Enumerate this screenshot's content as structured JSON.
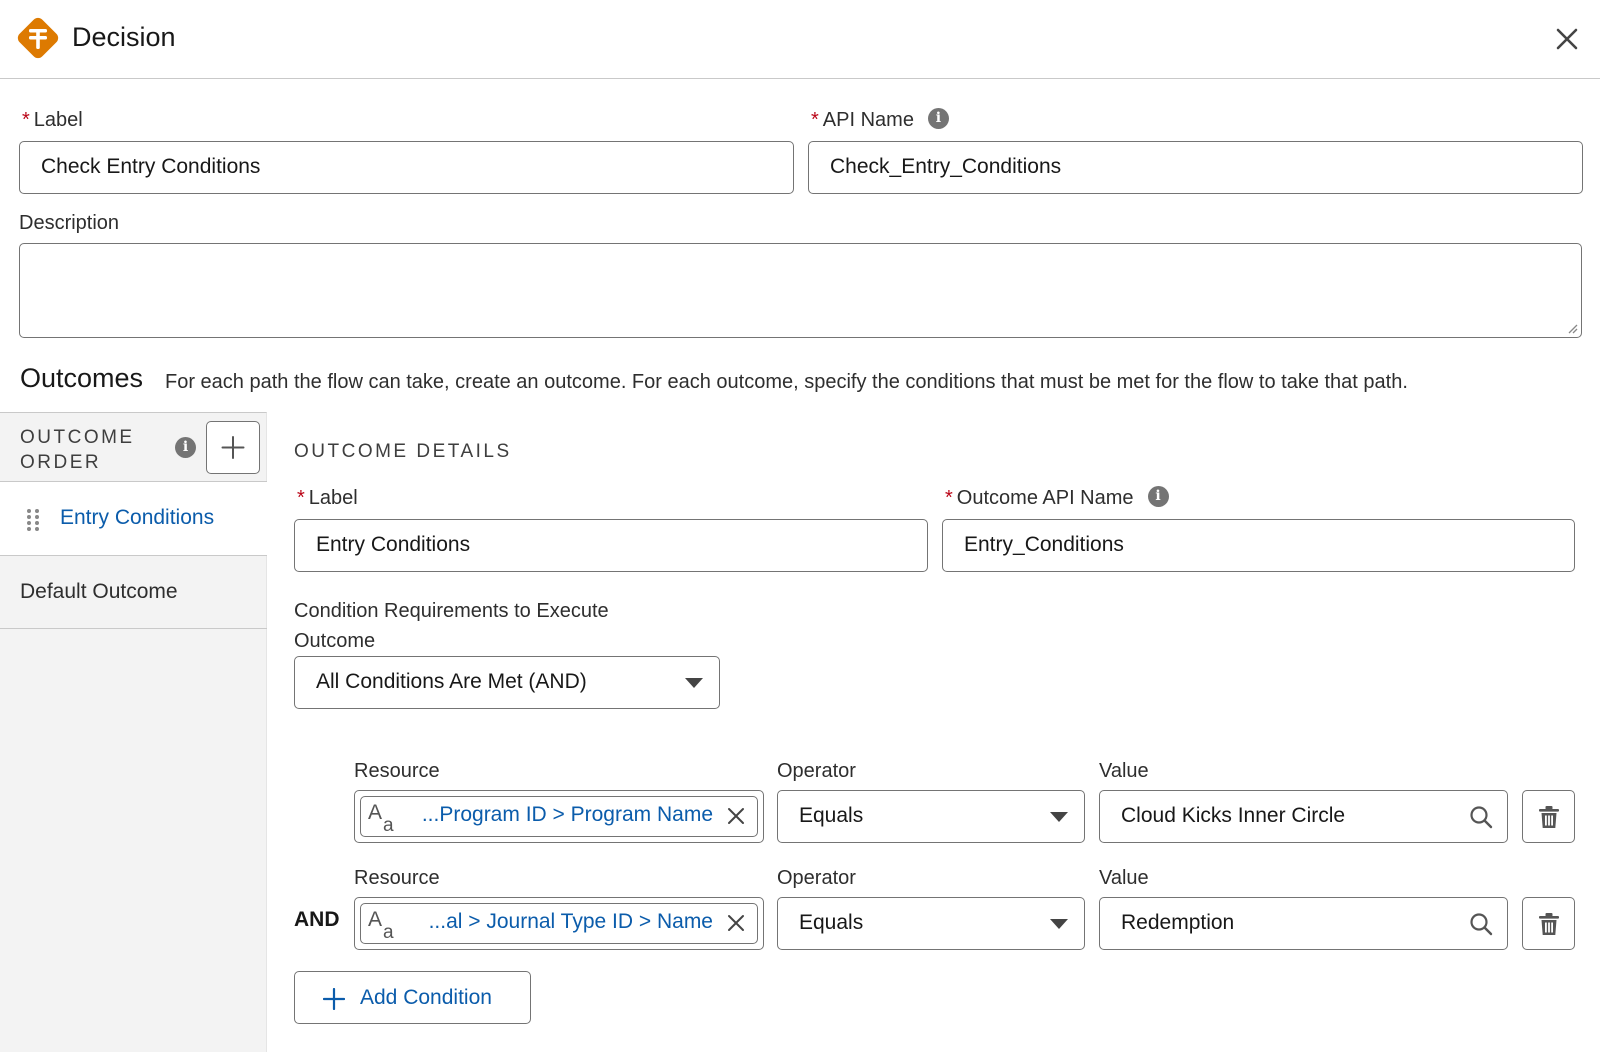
{
  "header": {
    "title": "Decision"
  },
  "form": {
    "label_field": {
      "label": "Label",
      "value": "Check Entry Conditions"
    },
    "api_name_field": {
      "label": "API Name",
      "value": "Check_Entry_Conditions"
    },
    "description_field": {
      "label": "Description",
      "value": ""
    }
  },
  "outcomes": {
    "title": "Outcomes",
    "description": "For each path the flow can take, create an outcome. For each outcome, specify the conditions that must be met for the flow to take that path.",
    "order_heading_line1": "OUTCOME",
    "order_heading_line2": "ORDER",
    "items": [
      {
        "label": "Entry Conditions"
      },
      {
        "label": "Default Outcome"
      }
    ]
  },
  "details": {
    "section_title": "OUTCOME DETAILS",
    "label_field": {
      "label": "Label",
      "value": "Entry Conditions"
    },
    "api_name_field": {
      "label": "Outcome API Name",
      "value": "Entry_Conditions"
    },
    "requirements_label_line1": "Condition Requirements to Execute",
    "requirements_label_line2": "Outcome",
    "requirements_value": "All Conditions Are Met (AND)",
    "conditions": [
      {
        "resource_label": "Resource",
        "resource_value": "...Program ID > Program Name",
        "operator_label": "Operator",
        "operator_value": "Equals",
        "value_label": "Value",
        "value": "Cloud Kicks Inner Circle"
      },
      {
        "logic": "AND",
        "resource_label": "Resource",
        "resource_value": "...al > Journal Type ID > Name",
        "operator_label": "Operator",
        "operator_value": "Equals",
        "value_label": "Value",
        "value": "Redemption"
      }
    ],
    "add_condition_label": "Add Condition"
  },
  "colors": {
    "brand_orange": "#dd7a01",
    "link_blue": "#0b5cab",
    "required_red": "#ba0517"
  }
}
